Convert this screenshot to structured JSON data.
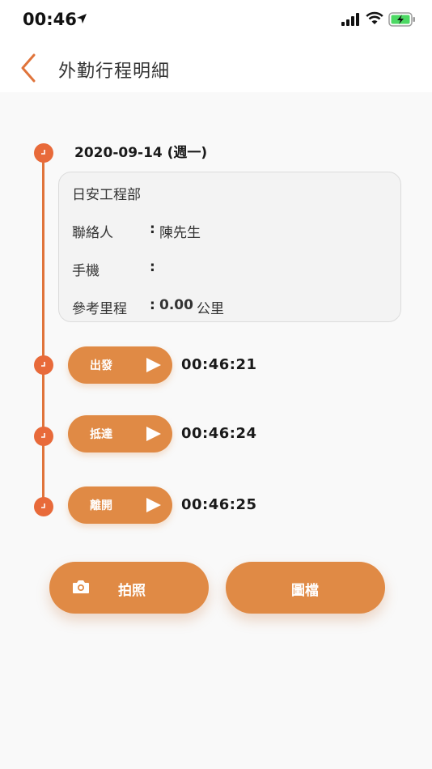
{
  "status_bar": {
    "time": "00:46"
  },
  "nav": {
    "title": "外勤行程明細"
  },
  "trip": {
    "date": "2020-09-14 (週一)",
    "company": "日安工程部",
    "contact_label": "聯絡人",
    "contact_value": "陳先生",
    "phone_label": "手機",
    "phone_value": "",
    "mileage_label": "參考里程",
    "mileage_value": "0.00",
    "mileage_unit": "公里",
    "colon": ":"
  },
  "steps": [
    {
      "label": "出發",
      "time": "00:46:21"
    },
    {
      "label": "抵達",
      "time": "00:46:24"
    },
    {
      "label": "離開",
      "time": "00:46:25"
    }
  ],
  "actions": {
    "photo_label": "拍照",
    "files_label": "圖檔"
  },
  "colors": {
    "accent": "#e08a45",
    "timeline": "#e86a3a",
    "back": "#e0743b"
  },
  "icons": [
    "location-arrow-icon",
    "signal-icon",
    "wifi-icon",
    "battery-icon",
    "back-chevron-icon",
    "clock-icon",
    "play-icon",
    "camera-icon"
  ]
}
